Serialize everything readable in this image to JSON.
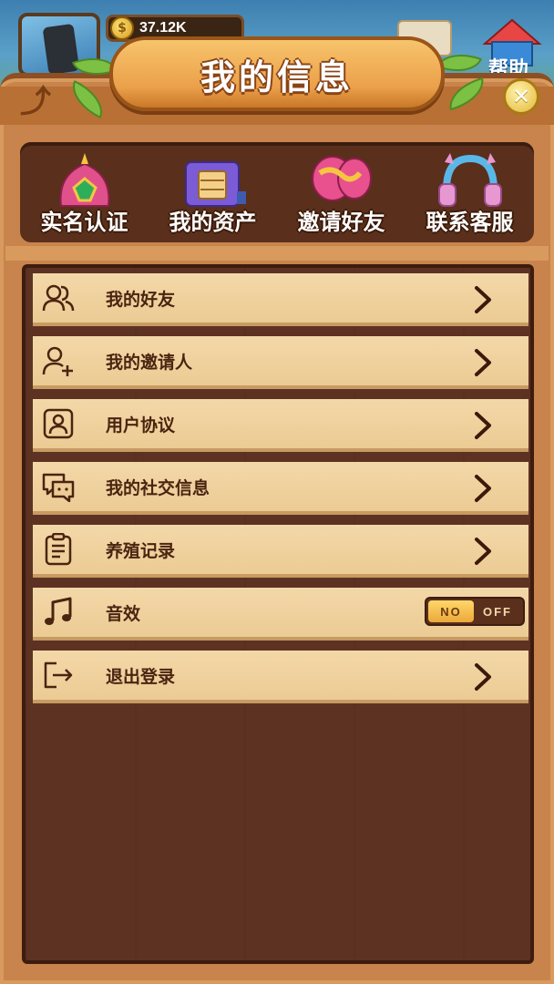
{
  "header": {
    "title": "我的信息",
    "coins": "37.12K",
    "coin_symbol": "$",
    "help_label": "帮助",
    "close_symbol": "✕"
  },
  "shortcuts": [
    {
      "label": "实名认证",
      "icon": "crown-gem-icon"
    },
    {
      "label": "我的资产",
      "icon": "treasure-box-icon"
    },
    {
      "label": "邀请好友",
      "icon": "balloons-icon"
    },
    {
      "label": "联系客服",
      "icon": "headphones-icon"
    }
  ],
  "menu": [
    {
      "label": "我的好友",
      "icon": "friends-icon"
    },
    {
      "label": "我的邀请人",
      "icon": "add-user-icon"
    },
    {
      "label": "用户协议",
      "icon": "contact-card-icon"
    },
    {
      "label": "我的社交信息",
      "icon": "chat-icon"
    },
    {
      "label": "养殖记录",
      "icon": "clipboard-icon"
    },
    {
      "label": "音效",
      "icon": "music-note-icon",
      "toggle_on": "NO",
      "toggle_off": "OFF"
    },
    {
      "label": "退出登录",
      "icon": "logout-icon"
    }
  ],
  "colors": {
    "panel": "#c8844c",
    "list_bg": "#5e3222",
    "item_bg": "#f3d8a8",
    "text": "#4a2410"
  }
}
